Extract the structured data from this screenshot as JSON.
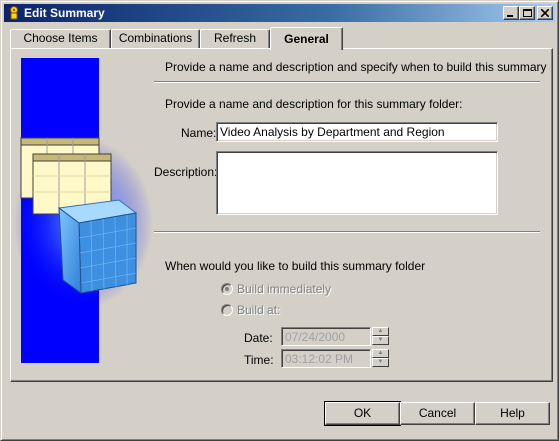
{
  "window": {
    "title": "Edit Summary",
    "minimize_icon": "minimize-icon",
    "maximize_icon": "maximize-icon",
    "close_icon": "close-icon"
  },
  "tabs": [
    {
      "label": "Choose Items",
      "active": false
    },
    {
      "label": "Combinations",
      "active": false
    },
    {
      "label": "Refresh",
      "active": false
    },
    {
      "label": "General",
      "active": true
    }
  ],
  "header": {
    "instruction": "Provide a name and description and specify when to build this summary"
  },
  "name_section": {
    "heading": "Provide a name and description for this summary folder:",
    "name_label": "Name:",
    "name_value": "Video Analysis by Department and Region",
    "description_label": "Description:",
    "description_value": ""
  },
  "build_section": {
    "heading": "When would you like to build this summary folder",
    "build_immediately_label": "Build immediately",
    "build_at_label": "Build at:",
    "selected": "build_immediately",
    "date_label": "Date:",
    "date_value": "07/24/2000",
    "time_label": "Time:",
    "time_value": "03:12:02 PM"
  },
  "buttons": {
    "ok": "OK",
    "cancel": "Cancel",
    "help": "Help"
  },
  "colors": {
    "title_bar": "#0a246a",
    "art_background": "#0000ff",
    "face": "#d4d0c8"
  }
}
